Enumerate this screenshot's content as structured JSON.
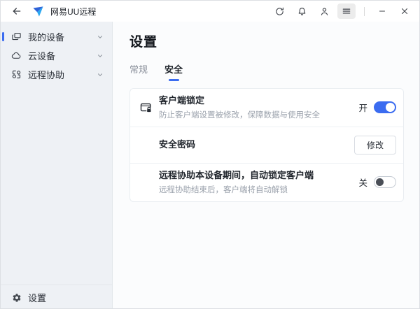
{
  "titlebar": {
    "app_title": "网易UU远程"
  },
  "sidebar": {
    "items": [
      {
        "label": "我的设备"
      },
      {
        "label": "云设备"
      },
      {
        "label": "远程协助"
      }
    ],
    "footer_label": "设置"
  },
  "main": {
    "page_title": "设置",
    "tabs": [
      {
        "label": "常规"
      },
      {
        "label": "安全"
      }
    ],
    "rows": {
      "client_lock": {
        "title": "客户端锁定",
        "description": "防止客户端设置被修改，保障数据与使用安全",
        "state_label": "开",
        "state": "on"
      },
      "security_password": {
        "title": "安全密码",
        "action_label": "修改"
      },
      "auto_lock": {
        "title": "远程协助本设备期间，自动锁定客户端",
        "description": "远程协助结束后，客户端将自动解锁",
        "state_label": "关",
        "state": "off"
      }
    }
  },
  "colors": {
    "accent_blue": "#3b6cf0",
    "sidebar_bg": "#eef1f5",
    "toggle_off_knob": "#4a4f57"
  }
}
